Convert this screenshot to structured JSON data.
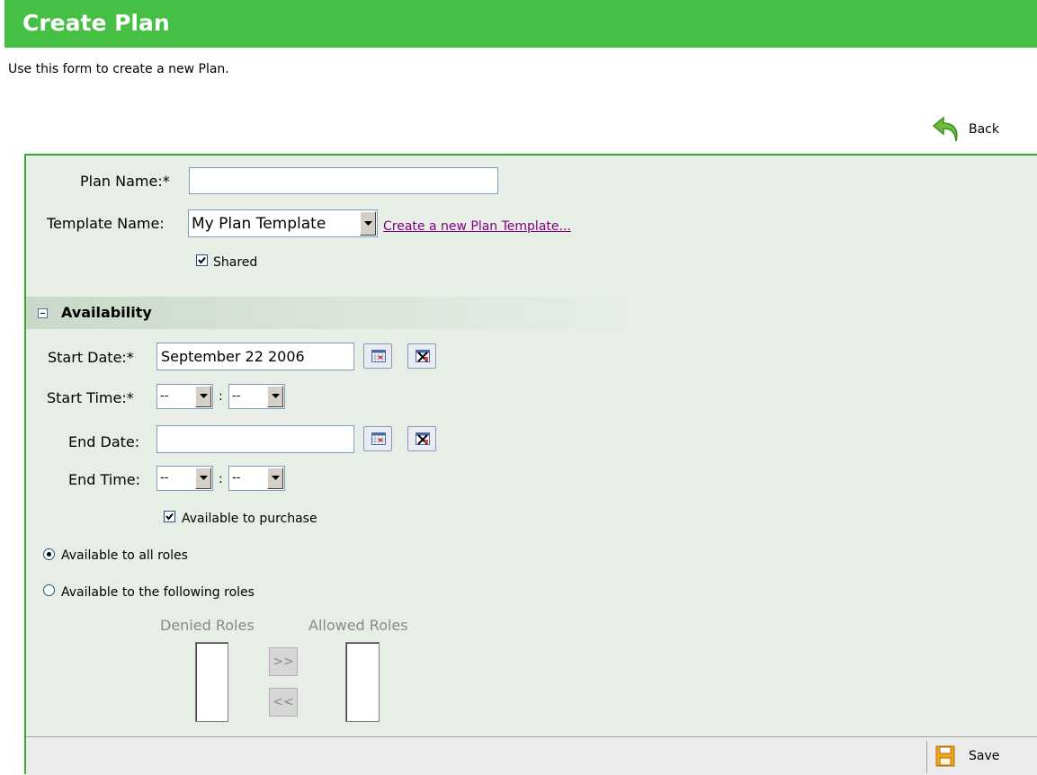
{
  "header": {
    "title": "Create Plan"
  },
  "intro": "Use this form to create a new Plan.",
  "nav": {
    "back_label": "Back"
  },
  "form": {
    "plan_name_label": "Plan Name:*",
    "plan_name_value": "",
    "template_name_label": "Template Name:",
    "template_selected": "My Plan Template",
    "create_template_link": "Create a new Plan Template...",
    "shared_label": "Shared",
    "shared_checked": true
  },
  "availability": {
    "section_title": "Availability",
    "start_date_label": "Start Date:*",
    "start_date_value": "September 22 2006",
    "start_time_label": "Start Time:*",
    "start_hour": "--",
    "start_minute": "--",
    "time_sep": ":",
    "end_date_label": "End Date:",
    "end_date_value": "",
    "end_time_label": "End Time:",
    "end_hour": "--",
    "end_minute": "--",
    "purchase_label": "Available to purchase",
    "purchase_checked": true,
    "all_roles_label": "Available to all roles",
    "following_roles_label": "Available to the following roles",
    "roles_selection": "all",
    "denied_roles_label": "Denied Roles",
    "allowed_roles_label": "Allowed Roles",
    "move_right_label": ">>",
    "move_left_label": "<<"
  },
  "footer": {
    "save_label": "Save"
  },
  "icons": {
    "back": "back-arrow-icon",
    "calendar": "calendar-icon",
    "clear": "clear-date-icon",
    "save": "save-icon"
  },
  "colors": {
    "header_green": "#45c045",
    "panel_bg": "#e6eee6",
    "link": "#800080"
  }
}
